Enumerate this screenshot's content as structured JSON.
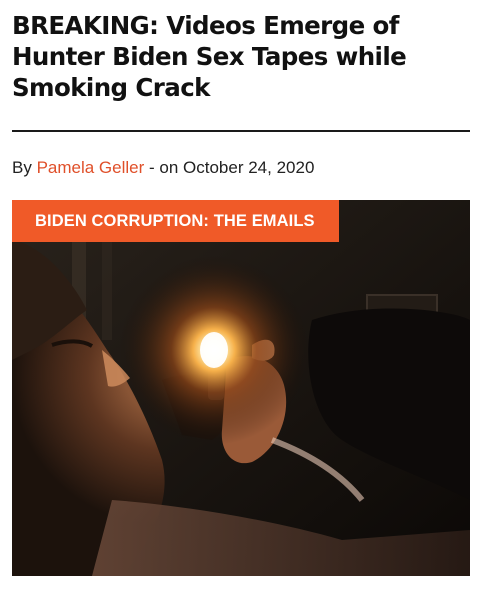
{
  "article": {
    "headline_lines": [
      "BREAKING: Videos Emerge of",
      "Hunter Biden Sex Tapes while",
      "Smoking Crack"
    ],
    "byline": {
      "prefix": "By ",
      "author": "Pamela Geller",
      "separator": " - on ",
      "date": "October 24, 2020"
    },
    "category_tag": "BIDEN CORRUPTION: THE EMAILS"
  },
  "colors": {
    "accent": "#f05a28",
    "author_link": "#e0502a",
    "headline": "#111111"
  }
}
